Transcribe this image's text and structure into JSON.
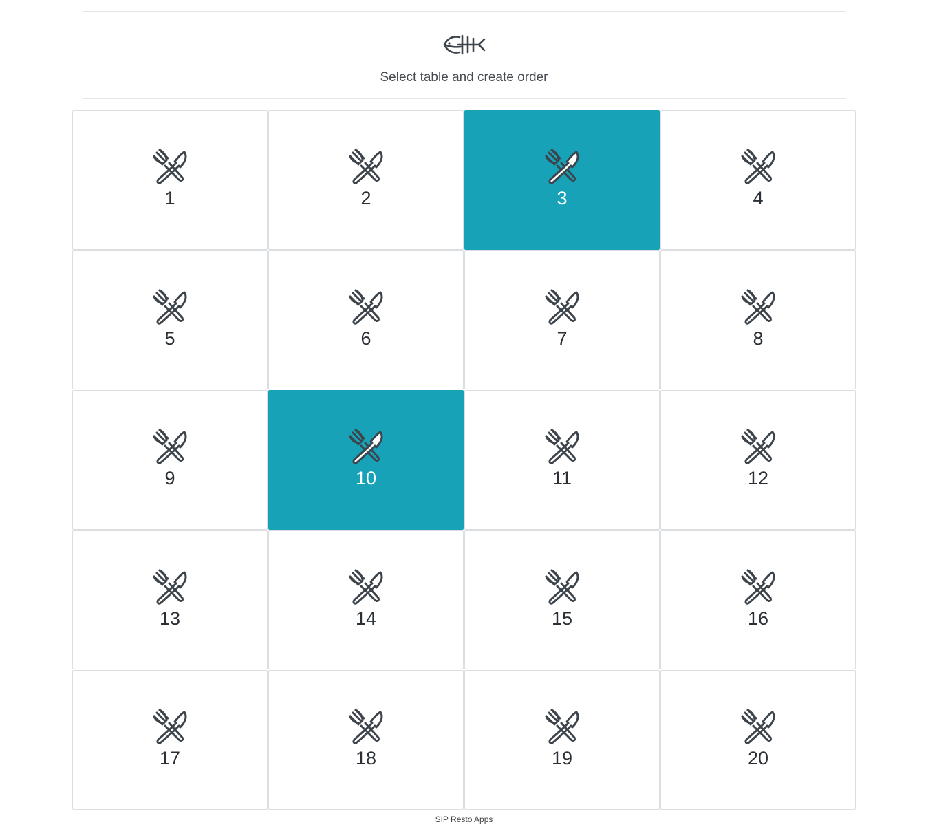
{
  "header": {
    "logo_icon": "fish-bone-icon",
    "subtitle": "Select table and create order"
  },
  "tables": [
    {
      "label": "1",
      "selected": false
    },
    {
      "label": "2",
      "selected": false
    },
    {
      "label": "3",
      "selected": true
    },
    {
      "label": "4",
      "selected": false
    },
    {
      "label": "5",
      "selected": false
    },
    {
      "label": "6",
      "selected": false
    },
    {
      "label": "7",
      "selected": false
    },
    {
      "label": "8",
      "selected": false
    },
    {
      "label": "9",
      "selected": false
    },
    {
      "label": "10",
      "selected": true
    },
    {
      "label": "11",
      "selected": false
    },
    {
      "label": "12",
      "selected": false
    },
    {
      "label": "13",
      "selected": false
    },
    {
      "label": "14",
      "selected": false
    },
    {
      "label": "15",
      "selected": false
    },
    {
      "label": "16",
      "selected": false
    },
    {
      "label": "17",
      "selected": false
    },
    {
      "label": "18",
      "selected": false
    },
    {
      "label": "19",
      "selected": false
    },
    {
      "label": "20",
      "selected": false
    }
  ],
  "table_icon": "fork-knife-icon",
  "colors": {
    "selected": "#17a2b8",
    "icon": "#3d444b"
  },
  "footer": {
    "text": "SIP Resto Apps"
  }
}
